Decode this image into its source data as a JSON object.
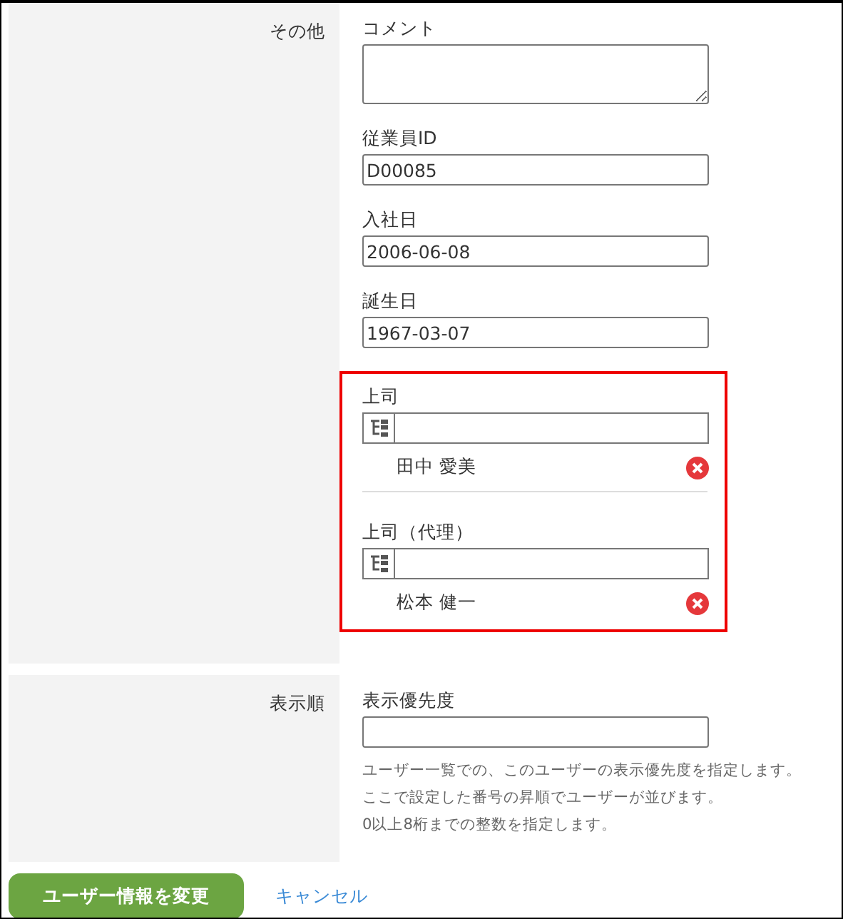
{
  "sections": [
    {
      "label": "その他",
      "fields": [
        {
          "kind": "textarea",
          "label": "コメント"
        },
        {
          "kind": "text",
          "label": "従業員ID",
          "value": "D00085"
        },
        {
          "kind": "text",
          "label": "入社日",
          "value": "2006-06-08"
        },
        {
          "kind": "text",
          "label": "誕生日",
          "value": "1967-03-07"
        },
        {
          "kind": "highlight",
          "fields": [
            {
              "kind": "user",
              "label": "上司",
              "users": [
                "田中 愛美"
              ]
            },
            {
              "kind": "user",
              "label": "上司（代理）",
              "users": [
                "松本 健一"
              ]
            }
          ]
        }
      ]
    },
    {
      "label": "表示順",
      "fields": [
        {
          "kind": "text",
          "label": "表示優先度",
          "help": [
            "ユーザー一覧での、このユーザーの表示優先度を指定します。",
            "ここで設定した番号の昇順でユーザーが並びます。",
            "0以上8桁までの整数を指定します。"
          ]
        }
      ]
    }
  ],
  "buttons": [
    {
      "kind": "primary",
      "label": "ユーザー情報を変更"
    },
    {
      "kind": "link",
      "label": "キャンセル"
    }
  ]
}
